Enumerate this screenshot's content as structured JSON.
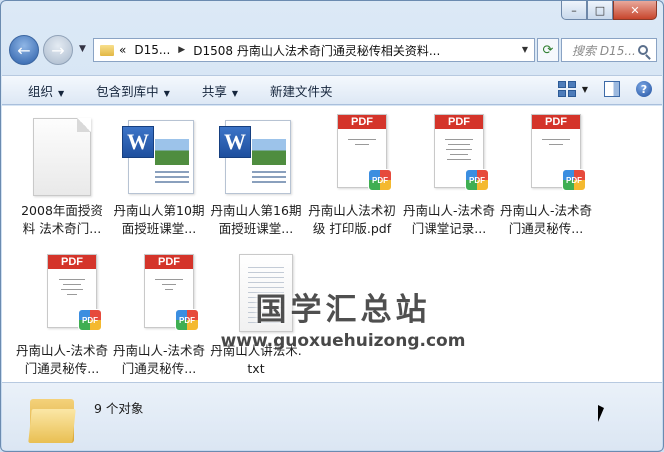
{
  "window": {
    "minimize": "–",
    "maximize": "□",
    "close": "✕"
  },
  "nav": {
    "back_glyph": "←",
    "forward_glyph": "→"
  },
  "address": {
    "overflow": "«",
    "crumbs": [
      "D15...",
      "D1508 丹南山人法术奇门通灵秘传相关资料..."
    ]
  },
  "search": {
    "placeholder": "搜索 D15..."
  },
  "toolbar": {
    "organize": "组织",
    "include_library": "包含到库中",
    "share": "共享",
    "new_folder": "新建文件夹"
  },
  "files": [
    {
      "name": "2008年面授资料 法术奇门...",
      "type": "blank"
    },
    {
      "name": "丹南山人第10期面授班课堂...",
      "type": "word"
    },
    {
      "name": "丹南山人第16期面授班课堂...",
      "type": "word"
    },
    {
      "name": "丹南山人法术初级 打印版.pdf",
      "type": "pdf"
    },
    {
      "name": "丹南山人-法术奇门课堂记录...",
      "type": "pdf"
    },
    {
      "name": "丹南山人-法术奇门通灵秘传...",
      "type": "pdf"
    },
    {
      "name": "丹南山人-法术奇门通灵秘传...",
      "type": "pdf"
    },
    {
      "name": "丹南山人-法术奇门通灵秘传...",
      "type": "pdf"
    },
    {
      "name": "丹南山人讲法术.txt",
      "type": "txt"
    }
  ],
  "pdf_label": "PDF",
  "pdf_badge": "PDF",
  "word_badge": "W",
  "watermark": {
    "title": "国学汇总站",
    "url": "www.guoxuehuizong.com"
  },
  "status": {
    "count": "9 个对象"
  }
}
